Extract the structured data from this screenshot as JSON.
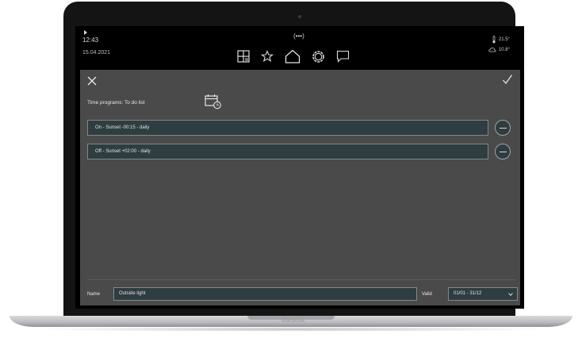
{
  "status": {
    "time": "12:43",
    "date": "15.04.2021",
    "network": "(•••)"
  },
  "weather": {
    "indoor": "21.5°",
    "outdoor": "10.8°"
  },
  "nav": {
    "icons": [
      "grid-list-icon",
      "star-icon",
      "home-icon",
      "gear-icon",
      "chat-icon"
    ]
  },
  "editor": {
    "title": "Time programs: To do list",
    "programs": [
      {
        "label": "On - Sunset -00:15 - daily"
      },
      {
        "label": "Off - Sunset +02:00 - daily"
      }
    ],
    "name_label": "Name",
    "name_value": "Outside light",
    "valid_label": "Valid",
    "valid_value": "01/01 - 31/12"
  },
  "device": {
    "brand": "MacBook"
  },
  "colors": {
    "panel": "#4a4a4a",
    "row": "#2f3d40",
    "border": "#7c8a8c"
  }
}
